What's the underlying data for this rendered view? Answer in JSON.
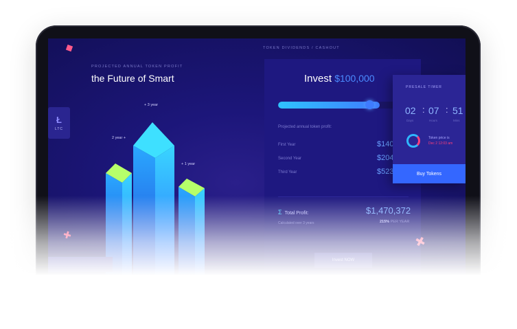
{
  "header": {
    "top_label": "TOKEN DIVIDENDS / CASHOUT",
    "projected_label": "PROJECTED ANNUAL TOKEN PROFIT",
    "headline": "the Future of Smart"
  },
  "coin": {
    "ticker": "LTC",
    "icon": "litecoin-icon"
  },
  "chart": {
    "labels": [
      "+ 3 year",
      "2 year +",
      "+ 1 year"
    ]
  },
  "invest": {
    "label": "Invest",
    "amount": "$100,000",
    "slider_fraction": 0.78,
    "projected_label": "Projected annual token profit:",
    "rows": [
      {
        "label": "First Year",
        "value": "$140"
      },
      {
        "label": "Second Year",
        "value": "$204"
      },
      {
        "label": "Third Year",
        "value": "$523"
      }
    ],
    "total_label": "Total Profit:",
    "total_value": "$1,470,372",
    "total_sub": "Calculated over 3 years",
    "pct": "215%",
    "pct_suffix": "PER YEAR",
    "bottom_button": "Invest NOW"
  },
  "presale": {
    "title": "PRESALE TIMER",
    "days": "02",
    "hours": "07",
    "mins": "51",
    "units": [
      "Days",
      "Hours",
      "Mins"
    ],
    "info_line1": "Token price is",
    "info_line2": "Dec 2 12:03 am",
    "buy_label": "Buy Tokens"
  },
  "colors": {
    "accent": "#3467ff",
    "cyan": "#2fc3ff",
    "pink": "#ff3f7a"
  }
}
